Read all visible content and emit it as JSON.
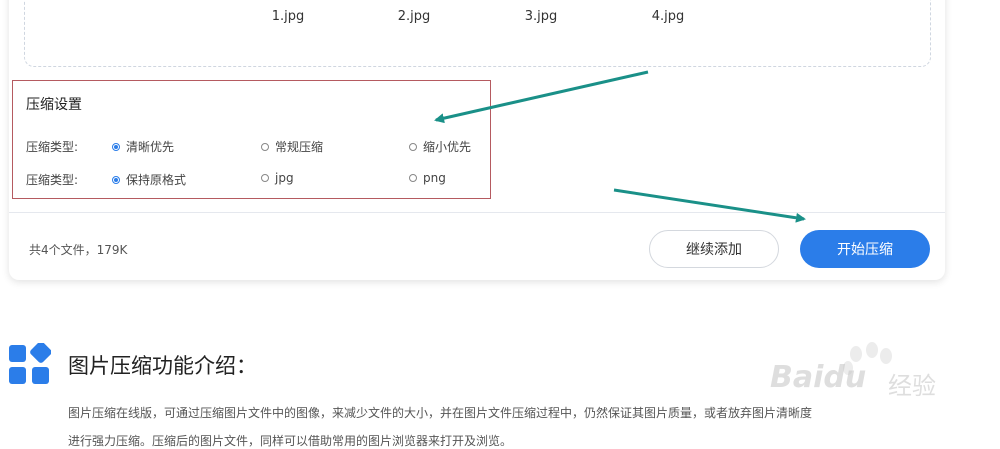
{
  "files": [
    {
      "name": "1.jpg",
      "thumb_color": "#e8e4df"
    },
    {
      "name": "2.jpg",
      "thumb_color": "#8a6a50"
    },
    {
      "name": "3.jpg",
      "thumb_color": "#b08260"
    },
    {
      "name": "4.jpg",
      "thumb_color": "#c4906a"
    }
  ],
  "settings": {
    "title": "压缩设置",
    "rows": [
      {
        "label": "压缩类型:",
        "options": [
          "清晰优先",
          "常规压缩",
          "缩小优先"
        ],
        "selected": 0
      },
      {
        "label": "压缩类型:",
        "options": [
          "保持原格式",
          "jpg",
          "png"
        ],
        "selected": 0
      }
    ]
  },
  "footer": {
    "summary": "共4个文件，179K",
    "add_label": "继续添加",
    "start_label": "开始压缩"
  },
  "intro": {
    "title": "图片压缩功能介绍：",
    "lines": [
      "图片压缩在线版，可通过压缩图片文件中的图像，来减少文件的大小，并在图片文件压缩过程中，仍然保证其图片质量，或者放弃图片清晰度",
      "进行强力压缩。压缩后的图片文件，同样可以借助常用的图片浏览器来打开及浏览。"
    ]
  },
  "watermark": {
    "text": "Bai",
    "text2": "du",
    "cn": "经验"
  },
  "colors": {
    "accent": "#2b7de9",
    "annotation_arrow": "#1a9088",
    "highlight_border": "#b55a60"
  }
}
